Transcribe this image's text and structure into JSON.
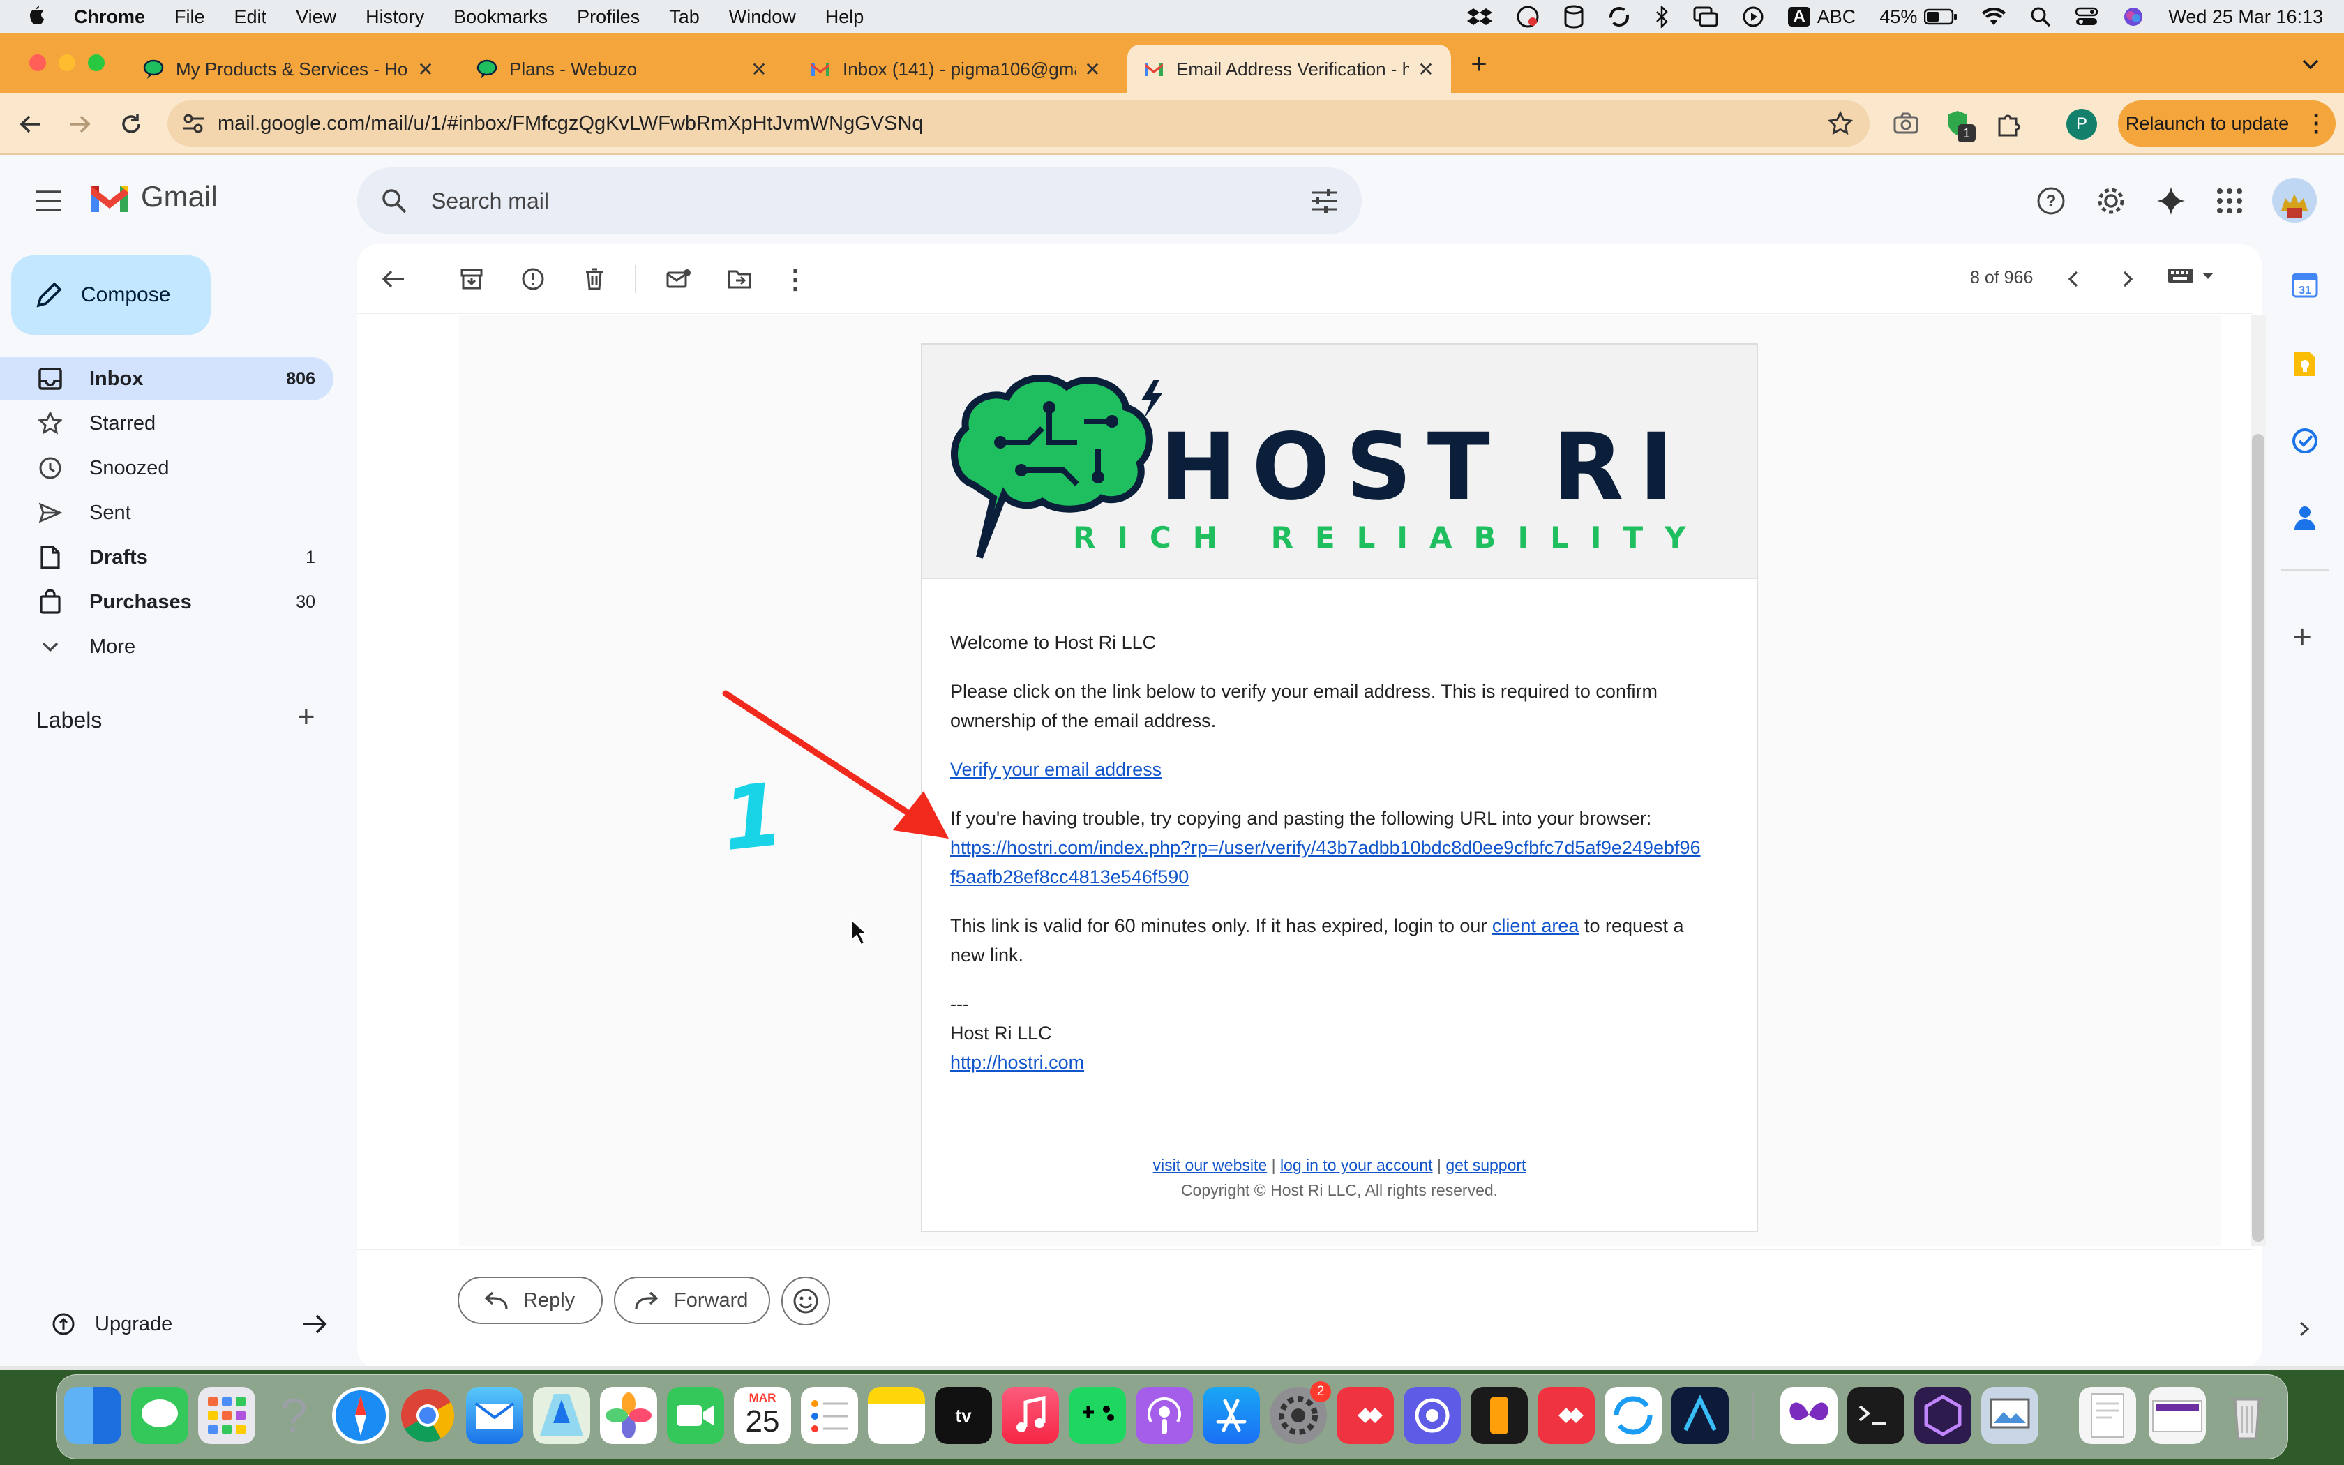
{
  "menubar": {
    "app": "Chrome",
    "items": [
      "File",
      "Edit",
      "View",
      "History",
      "Bookmarks",
      "Profiles",
      "Tab",
      "Window",
      "Help"
    ],
    "input_source": "ABC",
    "battery": "45%",
    "datetime": "Wed 25 Mar  16:13"
  },
  "tabs": [
    {
      "title": "My Products & Services - Ho"
    },
    {
      "title": "Plans - Webuzo"
    },
    {
      "title": "Inbox (141) - pigma106@gma"
    },
    {
      "title": "Email Address Verification - h"
    }
  ],
  "address_bar": {
    "url": "mail.google.com/mail/u/1/#inbox/FMfcgzQgKvLWFwbRmXpHtJvmWNgGVSNq",
    "extension_badge": "1",
    "profile_initial": "P",
    "relaunch_label": "Relaunch to update"
  },
  "gmail": {
    "logo_text": "Gmail",
    "search_placeholder": "Search mail",
    "compose_label": "Compose",
    "nav": [
      {
        "label": "Inbox",
        "count": "806"
      },
      {
        "label": "Starred",
        "count": ""
      },
      {
        "label": "Snoozed",
        "count": ""
      },
      {
        "label": "Sent",
        "count": ""
      },
      {
        "label": "Drafts",
        "count": "1"
      },
      {
        "label": "Purchases",
        "count": "30"
      },
      {
        "label": "More",
        "count": ""
      }
    ],
    "labels_heading": "Labels",
    "upgrade_label": "Upgrade",
    "pagination": "8 of 966",
    "reply_label": "Reply",
    "forward_label": "Forward"
  },
  "email": {
    "logo_main": "HOST RI",
    "logo_tagline": "RICH RELIABILITY",
    "greeting": "Welcome to Host Ri LLC",
    "para1_line1": "Please click on the link below to verify your email address. This is required to confirm",
    "para1_line2": "ownership of the email address.",
    "verify_link": "Verify your email address",
    "trouble_text": "If you're having trouble, try copying and pasting the following URL into your browser:",
    "url_line1": "https://hostri.com/index.php?rp=/user/verify/43b7adbb10bdc8d0ee9cfbfc7d5af9e249ebf96",
    "url_line2": "f5aafb28ef8cc4813e546f590",
    "validity_pre": "This link is valid for 60 minutes only. If it has expired, login to our ",
    "client_area_link": "client area",
    "validity_post": " to request a",
    "validity_line2": "new link.",
    "sig_sep": "---",
    "sig_name": "Host Ri LLC",
    "sig_link": "http://hostri.com",
    "footer_link1": "visit our website",
    "footer_link2": "log in to your account",
    "footer_link3": "get support",
    "footer_sep": "|",
    "copyright": "Copyright © Host Ri LLC, All rights reserved."
  },
  "annotation": {
    "number": "1",
    "arrow_color": "#f2291d",
    "number_color": "#19d3e6"
  },
  "dock": {
    "calendar_month": "MAR",
    "calendar_day": "25",
    "settings_badge": "2"
  },
  "colors": {
    "chrome_tabstrip": "#f4a53c",
    "chrome_toolbar": "#fbe7cc",
    "gmail_active_nav": "#d3e3fd",
    "compose_bg": "#c2e7ff",
    "brand_green": "#1fbf5f",
    "brand_navy": "#0b1f3a"
  }
}
